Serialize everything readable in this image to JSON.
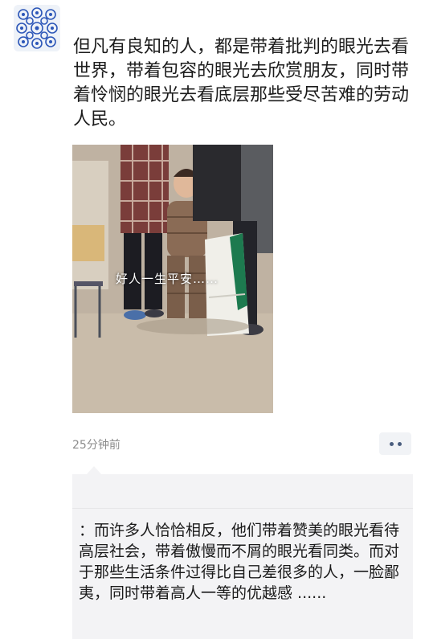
{
  "post": {
    "avatar_icon": "porcelain-pattern-avatar-icon",
    "text": "但凡有良知的人，都是带着批判的眼光去看世界，带着包容的眼光去欣赏朋友，同时带着怜悯的眼光去看底层那些受尽苦难的劳动人民。",
    "image_caption": "好人一生平安……",
    "timestamp": "25分钟前",
    "more_icon": "more-dots-icon"
  },
  "comment": {
    "author": "",
    "text": "：而许多人恰恰相反，他们带着赞美的眼光看待高层社会，带着傲慢而不屑的眼光看同类。而对于那些生活条件过得比自己差很多的人，一脸鄙夷，同时带着高人一等的优越感 ......"
  },
  "colors": {
    "link_blue": "#576b95",
    "comment_bg": "#f3f3f5",
    "timestamp_gray": "#8c8c8c"
  }
}
